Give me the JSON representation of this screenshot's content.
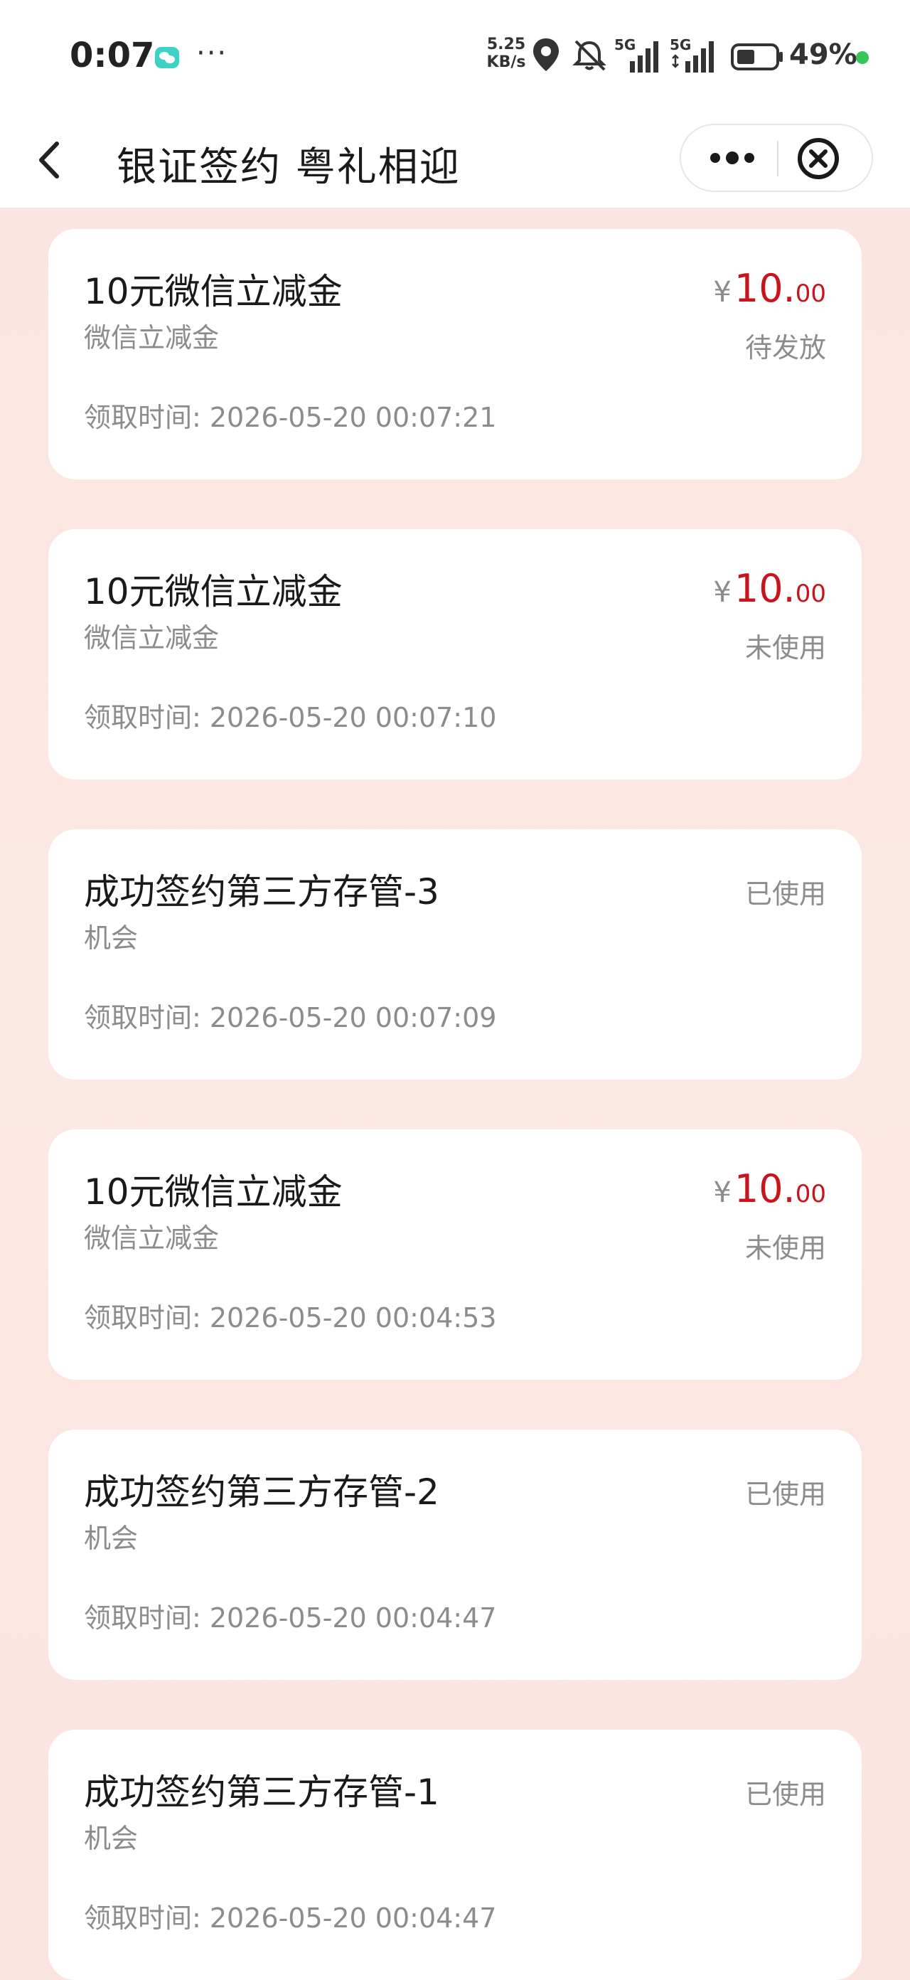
{
  "status_bar": {
    "time": "0:07",
    "more": "···",
    "net_speed_value": "5.25",
    "net_speed_unit": "KB/s",
    "signal_1_label": "5G",
    "signal_2_label": "5G",
    "battery_percent": "49%",
    "icons": [
      "wechat-icon",
      "location-icon",
      "mute-bell-icon",
      "signal-5g-icon",
      "signal-5g-icon",
      "battery-icon"
    ]
  },
  "header": {
    "title": "银证签约 粤礼相迎"
  },
  "colors": {
    "price_red": "#c9141e",
    "background_pink": "#fbe4df",
    "muted_gray": "#8c8c8c"
  },
  "records": [
    {
      "title": "10元微信立减金",
      "subtitle": "微信立减金",
      "time": "领取时间: 2026-05-20 00:07:21",
      "currency": "¥",
      "price_int": "10.",
      "price_dec": "00",
      "status": "待发放"
    },
    {
      "title": "10元微信立减金",
      "subtitle": "微信立减金",
      "time": "领取时间: 2026-05-20 00:07:10",
      "currency": "¥",
      "price_int": "10.",
      "price_dec": "00",
      "status": "未使用"
    },
    {
      "title": "成功签约第三方存管-3",
      "subtitle": "机会",
      "time": "领取时间: 2026-05-20 00:07:09",
      "status": "已使用"
    },
    {
      "title": "10元微信立减金",
      "subtitle": "微信立减金",
      "time": "领取时间: 2026-05-20 00:04:53",
      "currency": "¥",
      "price_int": "10.",
      "price_dec": "00",
      "status": "未使用"
    },
    {
      "title": "成功签约第三方存管-2",
      "subtitle": "机会",
      "time": "领取时间: 2026-05-20 00:04:47",
      "status": "已使用"
    },
    {
      "title": "成功签约第三方存管-1",
      "subtitle": "机会",
      "time": "领取时间: 2026-05-20 00:04:47",
      "status": "已使用"
    }
  ]
}
